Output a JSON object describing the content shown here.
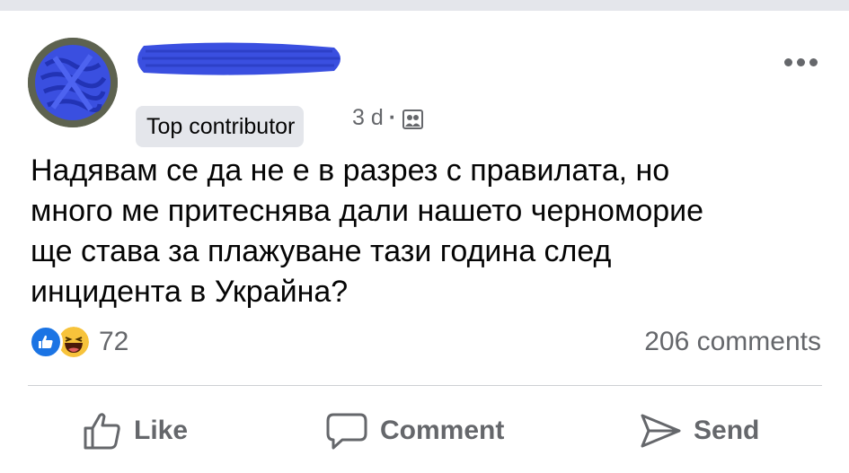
{
  "post": {
    "badge": "Top contributor",
    "time": "3 d",
    "separator": "·",
    "audience_icon": "group-audience-icon",
    "text": "Надявам се да не е в разрез с правилата, но\nмного ме притеснява дали нашето черноморие\nще става за плажуване тази година след\nинцидента в Украйна?",
    "reactions_count": "72",
    "reaction_icons": [
      "like-reaction-icon",
      "haha-reaction-icon"
    ],
    "comments_count": "206 comments",
    "more_icon": "more-options-icon"
  },
  "actions": {
    "like": "Like",
    "comment": "Comment",
    "send": "Send"
  },
  "colors": {
    "redaction": "#3a4fe0",
    "like_blue": "#1b74e4",
    "muted_text": "#65676b",
    "badge_bg": "#e4e6eb"
  }
}
